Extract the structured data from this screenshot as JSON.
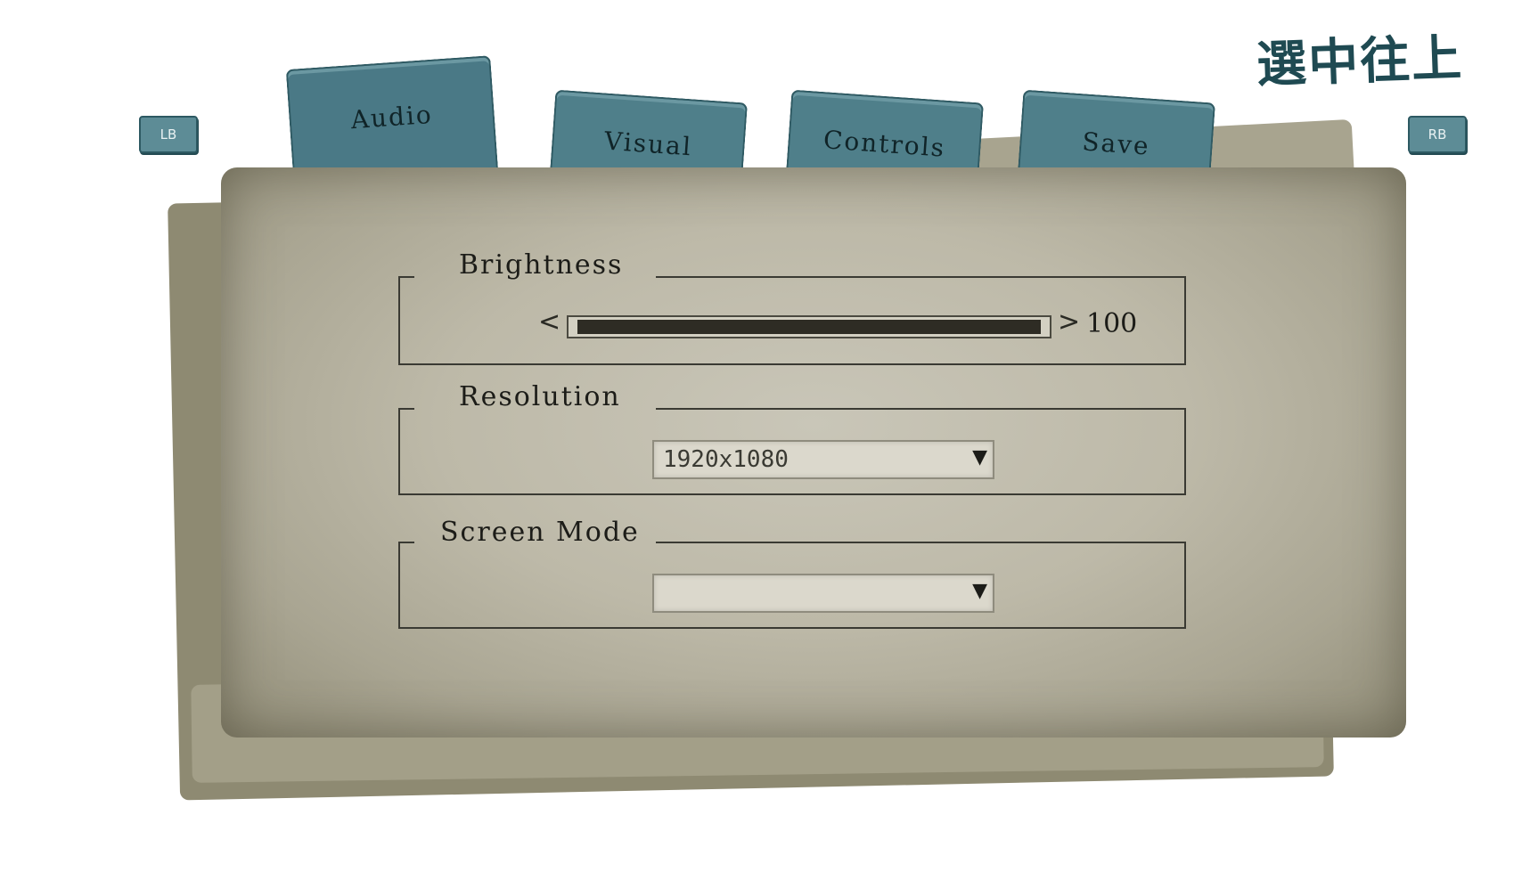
{
  "header": {
    "corner_label": "選中往上"
  },
  "shoulder_buttons": {
    "left": "LB",
    "right": "RB"
  },
  "tabs": [
    {
      "label": "Audio",
      "active": true
    },
    {
      "label": "Visual",
      "active": false
    },
    {
      "label": "Controls",
      "active": false
    },
    {
      "label": "Save",
      "active": false
    }
  ],
  "settings": {
    "brightness": {
      "title": "Brightness",
      "value": 100,
      "value_text": "100",
      "min": 0,
      "max": 100,
      "decrease_icon": "<",
      "increase_icon": ">"
    },
    "resolution": {
      "title": "Resolution",
      "selected": "1920x1080",
      "arrow_icon": "▼"
    },
    "screen_mode": {
      "title": "Screen Mode",
      "selected": "",
      "arrow_icon": "▼"
    }
  },
  "colors": {
    "tab": "#4f7f8a",
    "paper": "#bdb9a8",
    "accent_text": "#1f4a52"
  }
}
